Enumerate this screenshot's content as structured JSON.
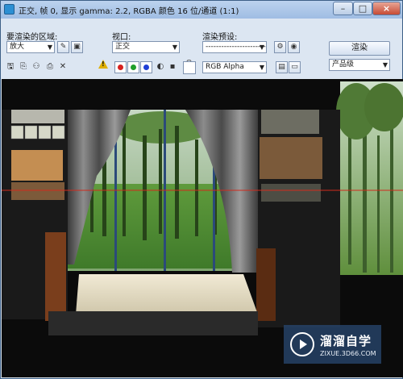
{
  "window": {
    "title": "正交, 帧 0, 显示 gamma: 2.2, RGBA 颜色 16 位/通道 (1:1)",
    "controls": {
      "minimize": "–",
      "maximize": "□",
      "close": "×"
    }
  },
  "panel": {
    "area_label": "要渲染的区域:",
    "area_value": "放大",
    "viewport_label": "视口:",
    "viewport_value": "正交",
    "preset_label": "渲染预设:",
    "preset_value": "-------------------------",
    "render_button": "渲染",
    "quality_value": "产品级",
    "channel_value": "RGB Alpha"
  },
  "icons": {
    "save": "save-icon",
    "copy": "copy-icon",
    "clone": "clone-icon",
    "print": "print-icon",
    "clear": "clear-icon",
    "lock": "lock-icon",
    "warning": "warning-icon"
  },
  "channels": {
    "red": "#d6211f",
    "green": "#1f9f2a",
    "blue": "#1f3fd6"
  },
  "watermark": {
    "title": "溜溜自学",
    "url": "ZIXUE.3D66.COM"
  }
}
